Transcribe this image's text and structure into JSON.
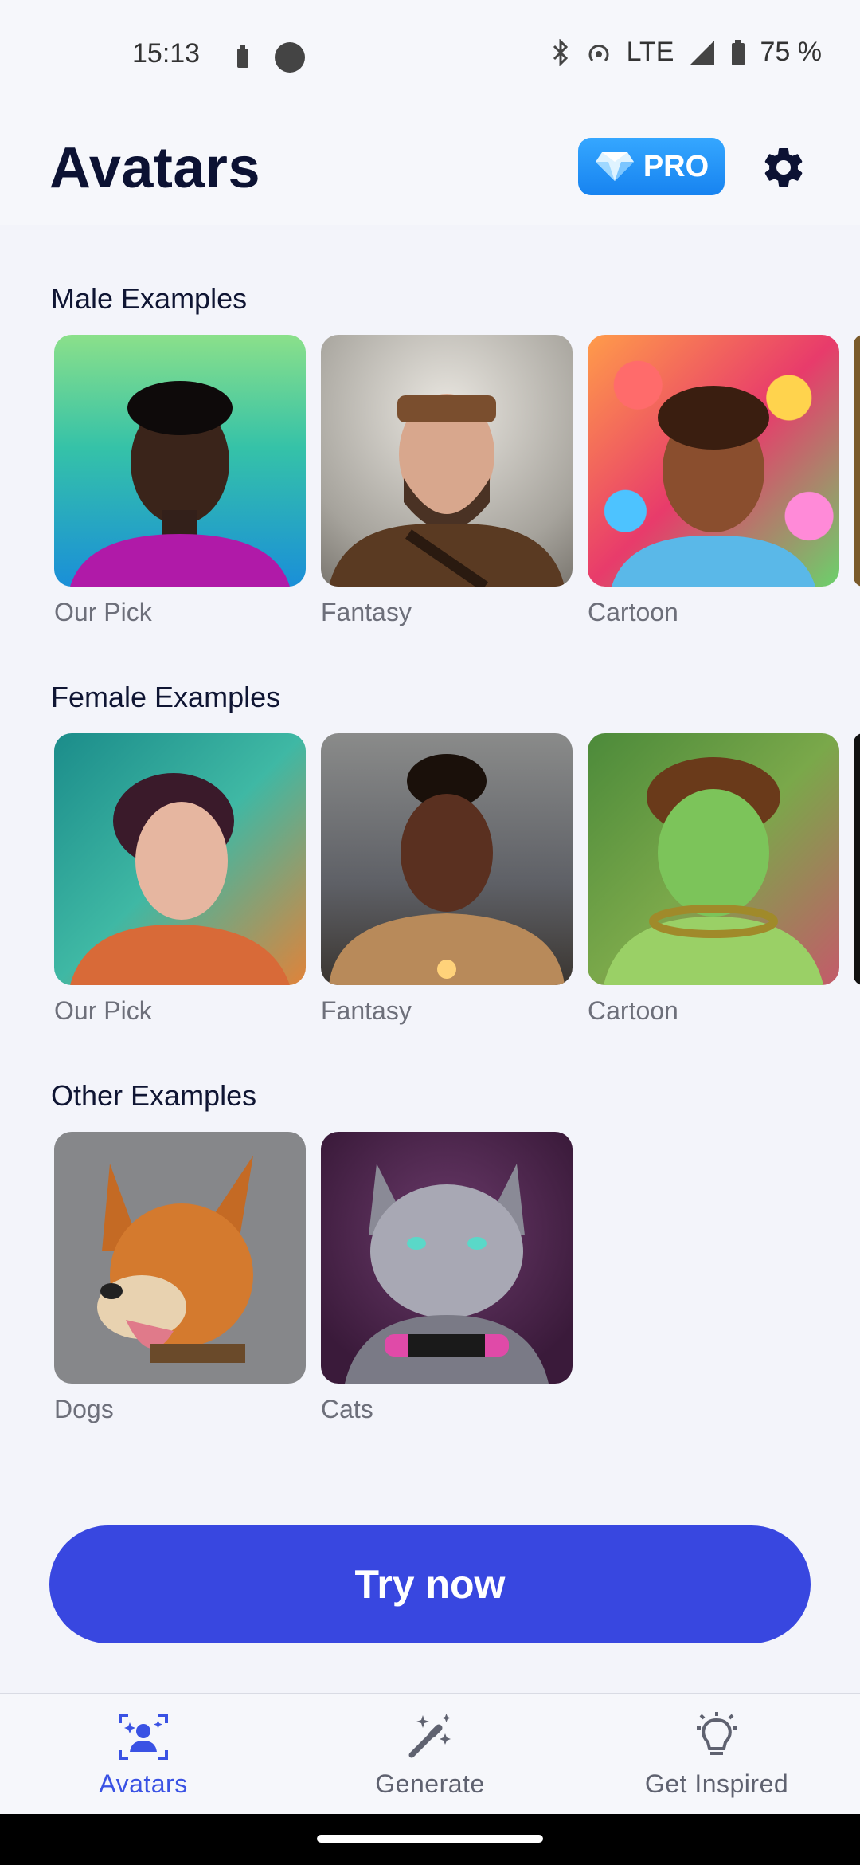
{
  "status_bar": {
    "time": "15:13",
    "network": "LTE",
    "battery": "75 %"
  },
  "header": {
    "title": "Avatars",
    "pro_label": "PRO"
  },
  "sections": [
    {
      "title": "Male Examples",
      "items": [
        "Our Pick",
        "Fantasy",
        "Cartoon"
      ]
    },
    {
      "title": "Female Examples",
      "items": [
        "Our Pick",
        "Fantasy",
        "Cartoon"
      ]
    },
    {
      "title": "Other Examples",
      "items": [
        "Dogs",
        "Cats"
      ]
    }
  ],
  "cta": {
    "label": "Try now"
  },
  "bottom_nav": [
    {
      "label": "Avatars",
      "icon": "avatar-sparkle-icon",
      "active": true
    },
    {
      "label": "Generate",
      "icon": "magic-wand-icon",
      "active": false
    },
    {
      "label": "Get Inspired",
      "icon": "lightbulb-icon",
      "active": false
    }
  ],
  "colors": {
    "accent": "#3847e0",
    "active_nav": "#3a52e4",
    "pro": "#1e8ff5"
  }
}
